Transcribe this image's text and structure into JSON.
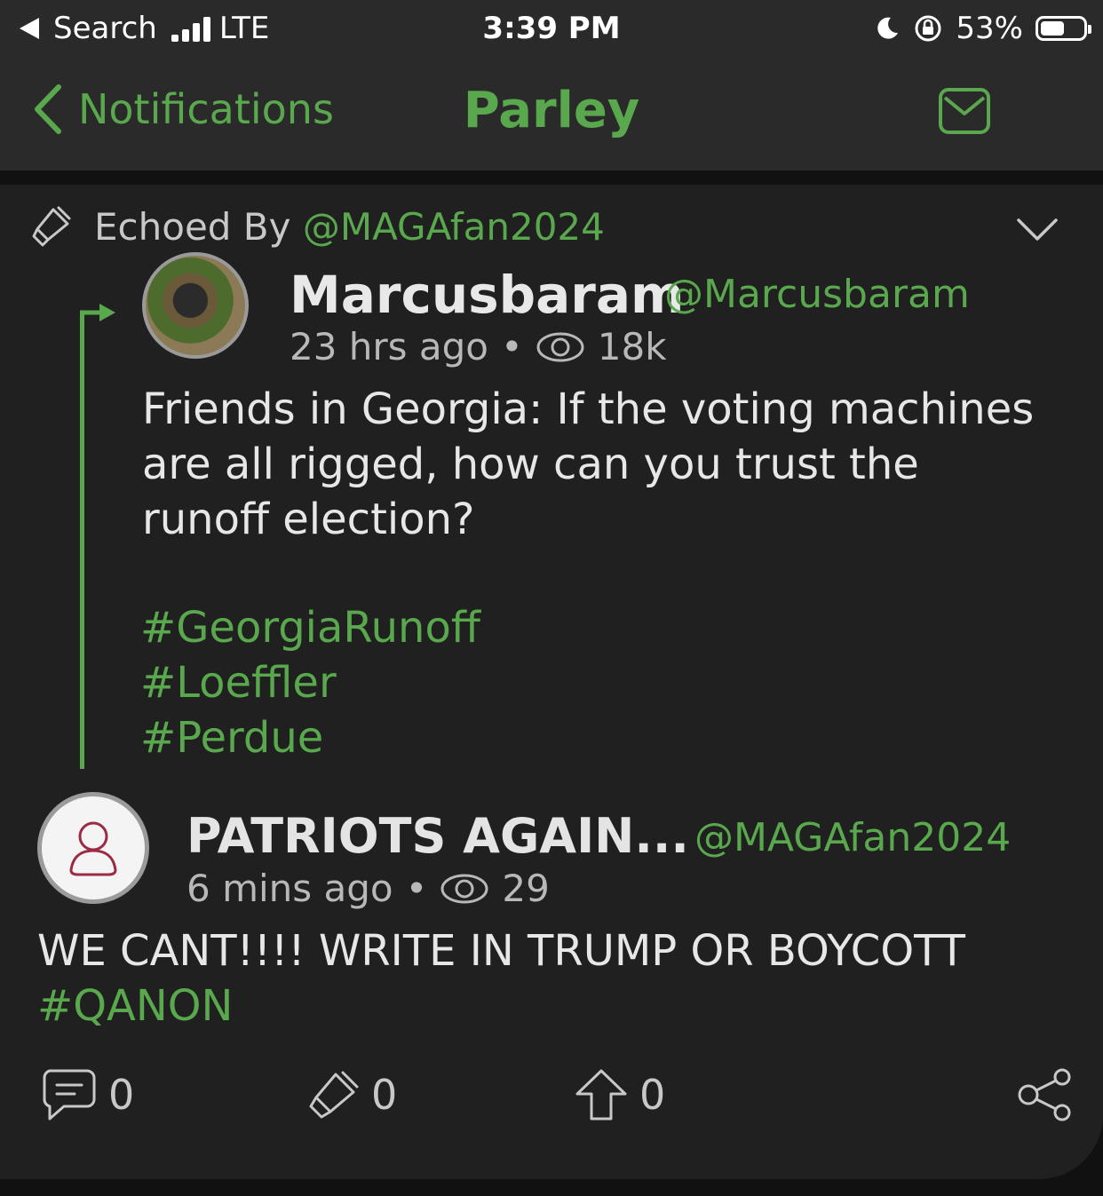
{
  "status_bar": {
    "back_app": "Search",
    "network": "LTE",
    "time": "3:39 PM",
    "battery": "53%",
    "battery_level": 0.53
  },
  "nav": {
    "back_label": "Notifications",
    "title": "Parley",
    "mail_icon": "envelope-icon",
    "accent_color": "#5aa84e"
  },
  "post": {
    "echo_prefix": "Echoed By",
    "echo_user": "@MAGAfan2024",
    "original": {
      "name": "Marcusbaram",
      "handle": "@Marcusbaram",
      "time": "23 hrs ago",
      "separator": "•",
      "views": "18k",
      "body": "Friends in Georgia: If the voting machines are all rigged, how can you trust the runoff election?",
      "hashtags": [
        "#GeorgiaRunoff",
        "#Loeffler",
        "#Perdue"
      ]
    },
    "reply": {
      "name": "PATRIOTS AGAIN...",
      "handle": "@MAGAfan2024",
      "time": "6 mins ago",
      "separator": "•",
      "views": "29",
      "body": "WE CANT!!!! WRITE IN TRUMP OR BOYCOTT",
      "hashtag": "#QANON"
    },
    "actions": {
      "comments": "0",
      "echoes": "0",
      "upvotes": "0"
    }
  }
}
